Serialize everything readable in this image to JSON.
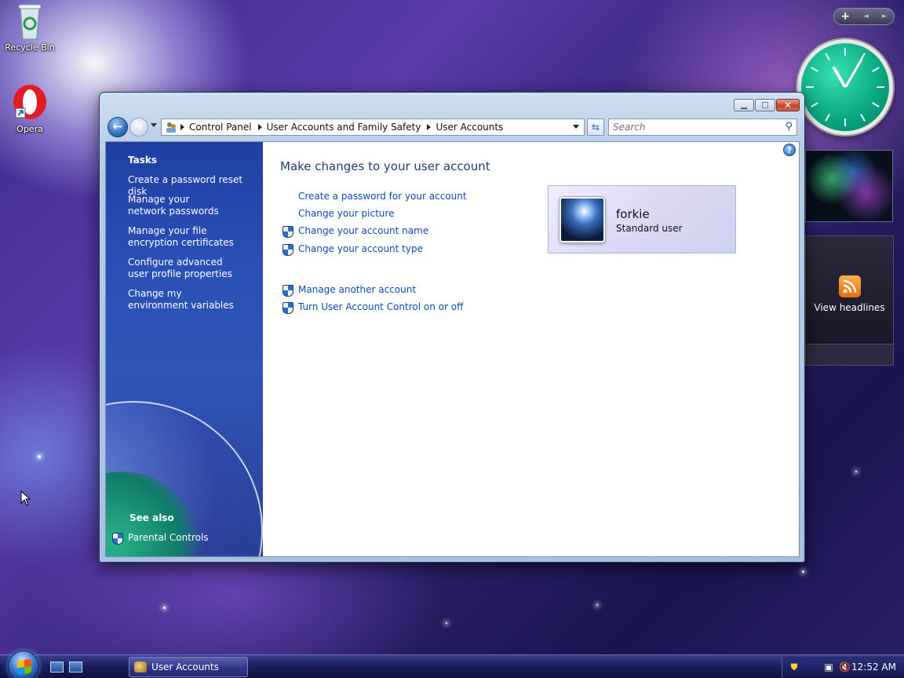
{
  "desktop": {
    "icons": [
      {
        "label": "Recycle Bin"
      },
      {
        "label": "Opera"
      }
    ]
  },
  "gadgets": {
    "toolbar": {
      "add": "+",
      "prev": "◄",
      "next": "►"
    },
    "feed_label": "View headlines"
  },
  "window": {
    "address": {
      "crumbs": [
        "Control Panel",
        "User Accounts and Family Safety",
        "User Accounts"
      ]
    },
    "search_placeholder": "Search",
    "help": "?",
    "tasks": {
      "heading": "Tasks",
      "links": [
        "Create a password reset disk",
        "Manage your network passwords",
        "Manage your file encryption certificates",
        "Configure advanced user profile properties",
        "Change my environment variables"
      ],
      "see_also_heading": "See also",
      "see_also_links": [
        "Parental Controls"
      ]
    },
    "main": {
      "title": "Make changes to your user account",
      "links": [
        "Create a password for your account",
        "Change your picture",
        "Change your account name",
        "Change your account type"
      ],
      "other_links": [
        "Manage another account",
        "Turn User Account Control on or off"
      ]
    },
    "user": {
      "name": "forkie",
      "type": "Standard user"
    }
  },
  "taskbar": {
    "task_label": "User Accounts",
    "time": "12:52 AM"
  }
}
